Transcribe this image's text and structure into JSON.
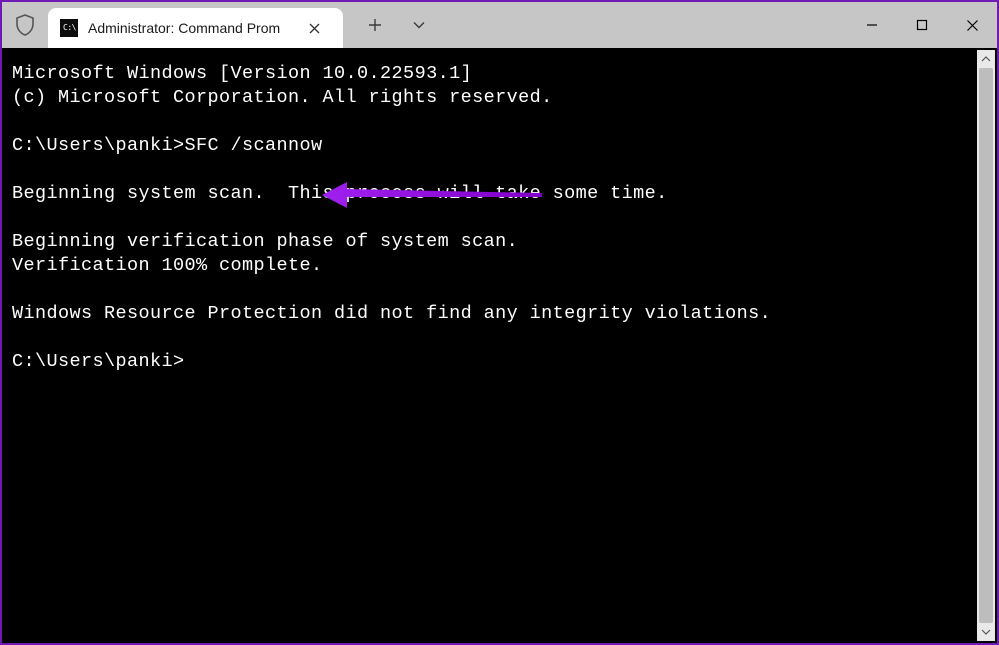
{
  "window": {
    "tab_title": "Administrator: Command Prom",
    "tab_icon_text": "C:\\"
  },
  "terminal": {
    "line1": "Microsoft Windows [Version 10.0.22593.1]",
    "line2": "(c) Microsoft Corporation. All rights reserved.",
    "blank": "",
    "prompt1_prefix": "C:\\Users\\panki>",
    "prompt1_cmd": "SFC /scannow",
    "line4": "Beginning system scan.  This process will take some time.",
    "line5": "Beginning verification phase of system scan.",
    "line6": "Verification 100% complete.",
    "line7": "Windows Resource Protection did not find any integrity violations.",
    "prompt2": "C:\\Users\\panki>"
  },
  "colors": {
    "frame": "#6f1ab5",
    "titlebar": "#c6c6c6",
    "terminal_bg": "#000000",
    "terminal_fg": "#ffffff",
    "annotation": "#a020f0"
  }
}
